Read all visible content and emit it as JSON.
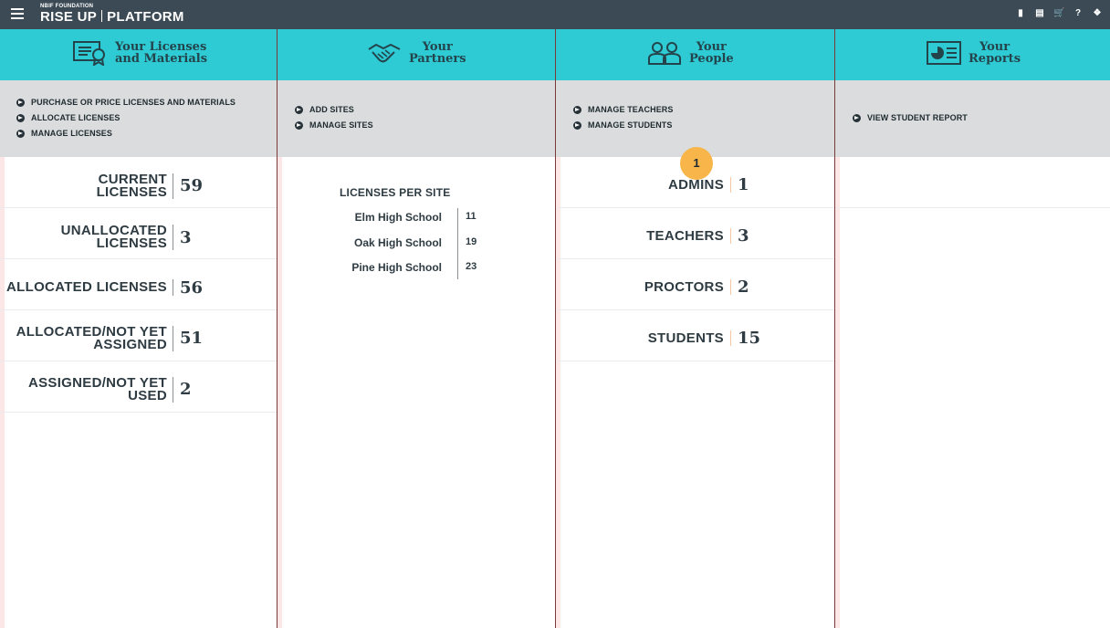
{
  "topbar": {
    "foundation": "NBIF FOUNDATION",
    "brand_left": "RISE UP",
    "brand_right": "PLATFORM",
    "icons": [
      "document-icon",
      "list-document-icon",
      "cart-icon",
      "help-icon",
      "info-icon"
    ]
  },
  "columns": {
    "licenses": {
      "title_line1": "Your Licenses",
      "title_line2": "and Materials",
      "links": [
        "PURCHASE OR PRICE LICENSES AND MATERIALS",
        "ALLOCATE LICENSES",
        "MANAGE LICENSES"
      ],
      "stats": [
        {
          "line1": "CURRENT",
          "line2": "LICENSES",
          "value": "59"
        },
        {
          "line1": "UNALLOCATED",
          "line2": "LICENSES",
          "value": "3"
        },
        {
          "line1": "ALLOCATED LICENSES",
          "line2": "",
          "value": "56"
        },
        {
          "line1": "ALLOCATED/NOT YET",
          "line2": "ASSIGNED",
          "value": "51"
        },
        {
          "line1": "ASSIGNED/NOT YET",
          "line2": "USED",
          "value": "2"
        }
      ]
    },
    "partners": {
      "title_line1": "Your",
      "title_line2": "Partners",
      "links": [
        "ADD SITES",
        "MANAGE SITES"
      ],
      "licenses_per_site_title": "LICENSES PER SITE",
      "sites": [
        {
          "name": "Elm High School",
          "count": "11"
        },
        {
          "name": "Oak High School",
          "count": "19"
        },
        {
          "name": "Pine High School",
          "count": "23"
        }
      ]
    },
    "people": {
      "title_line1": "Your",
      "title_line2": "People",
      "links": [
        "MANAGE TEACHERS",
        "MANAGE STUDENTS"
      ],
      "badge": "1",
      "counts": [
        {
          "label": "ADMINS",
          "value": "1"
        },
        {
          "label": "TEACHERS",
          "value": "3"
        },
        {
          "label": "PROCTORS",
          "value": "2"
        },
        {
          "label": "STUDENTS",
          "value": "15"
        }
      ]
    },
    "reports": {
      "title_line1": "Your",
      "title_line2": "Reports",
      "links": [
        "VIEW STUDENT REPORT"
      ]
    }
  },
  "colors": {
    "topbar": "#3b4a54",
    "header": "#2ecbd4",
    "links_panel": "#dadcdd",
    "badge": "#f8b54a"
  }
}
